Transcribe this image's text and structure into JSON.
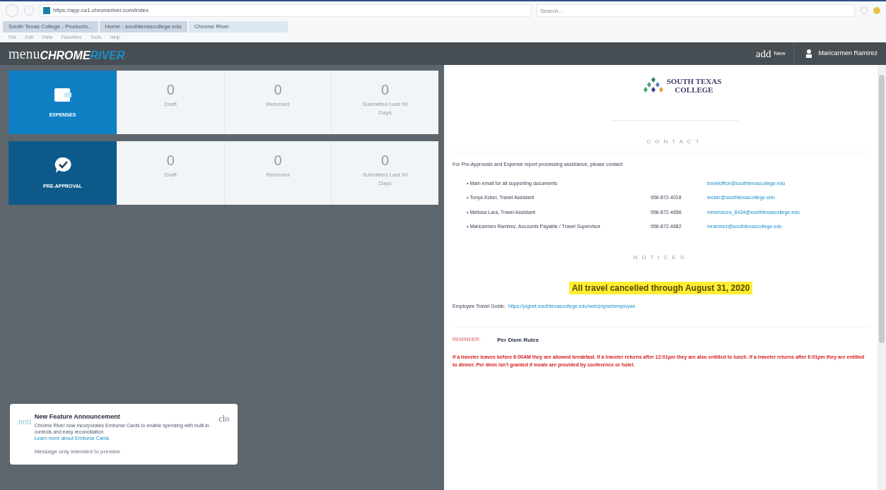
{
  "browser": {
    "url": "https://app.ca1.chromeriver.com/index",
    "search": {
      "placeholder": "Search..."
    },
    "tabs": [
      {
        "label": "South Texas College - Products...",
        "selected": false
      },
      {
        "label": "Home - southtexascollege.edu",
        "selected": false
      },
      {
        "label": "Chrome River",
        "selected": true
      }
    ],
    "menu": [
      "File",
      "Edit",
      "View",
      "Favorites",
      "Tools",
      "Help"
    ]
  },
  "header": {
    "logo": {
      "prefix": "menu",
      "brand_1": "CHROME",
      "brand_2": "RIVER"
    },
    "add": {
      "word": "add",
      "label": "New"
    },
    "user": "Maricarmen Ramirez"
  },
  "modules": [
    {
      "kind": "expenses",
      "title": "EXPENSES",
      "selected": true,
      "stats": [
        {
          "count": "0",
          "label": "Draft"
        },
        {
          "count": "0",
          "label": "Returned"
        },
        {
          "count": "0",
          "label": "Submitted Last 90 Days"
        }
      ]
    },
    {
      "kind": "preapproval",
      "title": "PRE-APPROVAL",
      "selected": false,
      "stats": [
        {
          "count": "0",
          "label": "Draft"
        },
        {
          "count": "0",
          "label": "Returned"
        },
        {
          "count": "0",
          "label": "Submitted Last 90 Days"
        }
      ]
    }
  ],
  "notification": {
    "tag": "noti",
    "title": "New Feature Announcement",
    "body": "Chrome River now incorporates Emburse Cards to enable spending with built-in controls and easy reconciliation.",
    "link": "Learn more about Emburse Cards",
    "footnote": "Message only intended to preview",
    "close": "clo"
  },
  "panel": {
    "college": {
      "line_1": "SOUTH TEXAS",
      "line_2": "COLLEGE"
    },
    "contact_heading": "CONTACT",
    "intro": "For Pre-Approvals and Expense report processing assistance, please contact:",
    "contacts": [
      {
        "name": "• Main email for all supporting documents",
        "email": "traveloffice@southtexascollege.edu"
      },
      {
        "name": "• Tonya Ecker, Travel Assistant",
        "phone": "956-872-4018",
        "email": "tecker@southtexascollege.edu"
      },
      {
        "name": "• Melissa Lara, Travel Assistant",
        "phone": "956-872-4656",
        "email": "mmendoza_8434@southtexascollege.edu"
      },
      {
        "name": "• Maricarmen Ramirez, Accounts Payable / Travel Supervisor",
        "phone": "956-872-4682",
        "email": "mramirez@southtexascollege.edu"
      }
    ],
    "notices_heading": "NOTICES",
    "alert": "All travel cancelled through August 31, 2020",
    "guide_label": "Employee Travel Guide:",
    "guide_link": "https://pignet.southtexascollege.edu/web/pignet/employee",
    "reminder_tag": "REMINDER:",
    "reminder_title": "Per Diem Rules",
    "rules": "If a traveler leaves before 6:00AM they are allowed breakfast. If a traveler returns after 12:01pm they are also entitled to lunch. If a traveler returns after 6:01pm they are entitled to dinner. Per diem isn't granted if meals are provided by conference or hotel."
  }
}
